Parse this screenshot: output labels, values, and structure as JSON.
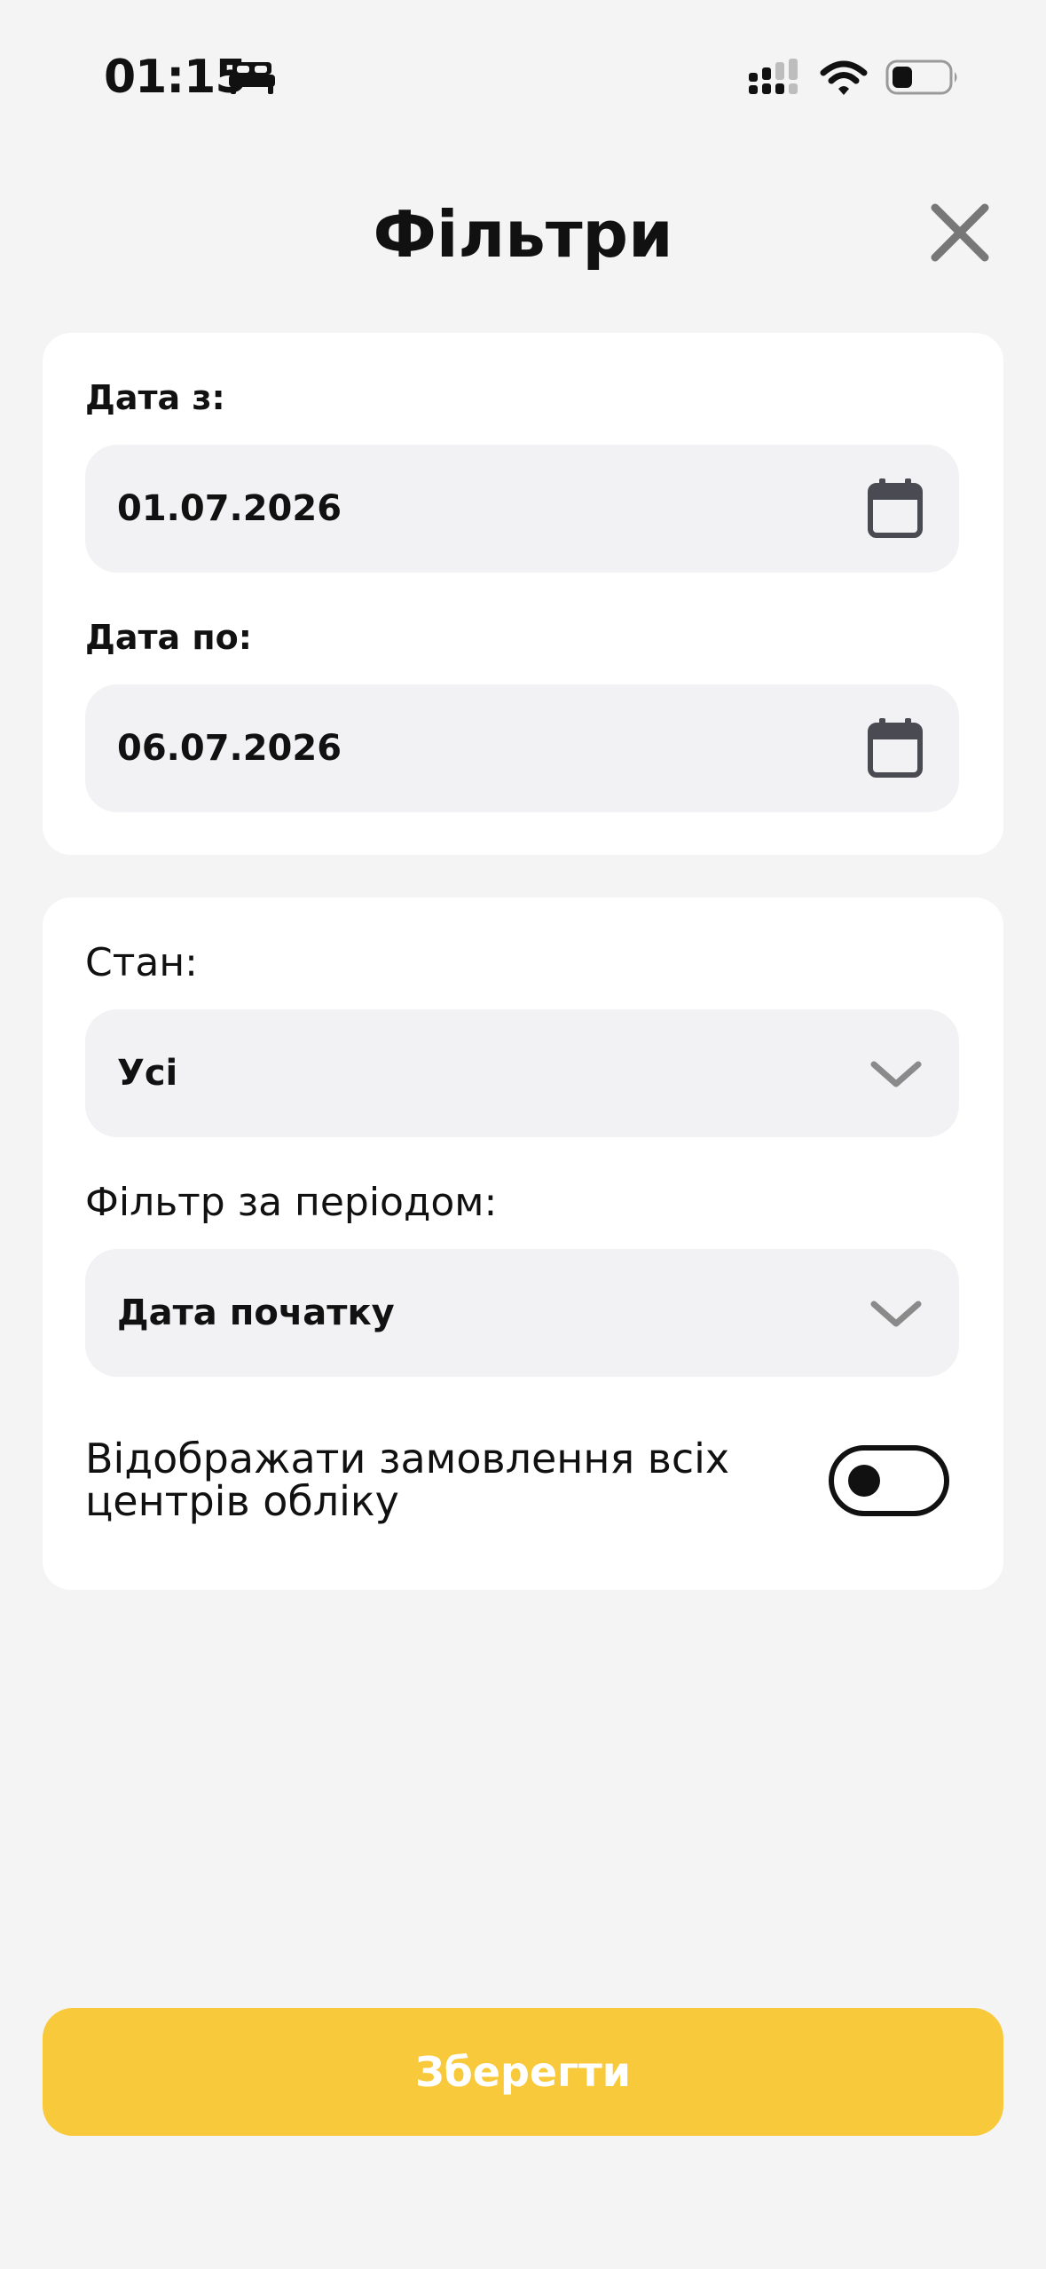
{
  "status_bar": {
    "time": "01:15",
    "icons": [
      "bed-icon",
      "signal-icon",
      "wifi-icon",
      "battery-icon"
    ]
  },
  "header": {
    "title": "Фільтри",
    "close_icon": "close-icon"
  },
  "dates": {
    "from": {
      "label": "Дата з:",
      "value": "01.07.2026",
      "icon": "calendar-icon"
    },
    "to": {
      "label": "Дата по:",
      "value": "06.07.2026",
      "icon": "calendar-icon"
    }
  },
  "filters": {
    "state": {
      "label": "Стан:",
      "value": "Усі",
      "icon": "chevron-down-icon"
    },
    "period": {
      "label": "Фільтр за періодом:",
      "value": "Дата початку",
      "icon": "chevron-down-icon"
    },
    "all_centers": {
      "label": "Відображати замовлення всіх центрів обліку",
      "enabled": false
    }
  },
  "save_button": {
    "label": "Зберегти"
  },
  "colors": {
    "background": "#f4f4f4",
    "card": "#ffffff",
    "field": "#f2f2f4",
    "accent": "#f8c93a",
    "icon_gray": "#7a7a7a"
  }
}
